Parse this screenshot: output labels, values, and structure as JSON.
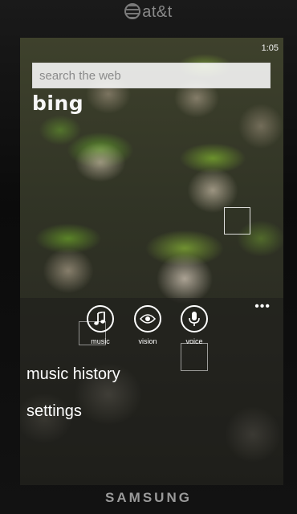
{
  "device": {
    "carrier": "at&t",
    "brand": "SAMSUNG"
  },
  "status": {
    "time": "1:05"
  },
  "search": {
    "placeholder": "search the web",
    "value": ""
  },
  "logo": "bing",
  "actions": [
    {
      "label": "music",
      "icon": "music-note-icon"
    },
    {
      "label": "vision",
      "icon": "eye-icon"
    },
    {
      "label": "voice",
      "icon": "microphone-icon"
    }
  ],
  "more": "•••",
  "menu": [
    {
      "label": "music history"
    },
    {
      "label": "settings"
    }
  ],
  "colors": {
    "foreground": "#ffffff",
    "search_box": "#e6e6e6"
  }
}
